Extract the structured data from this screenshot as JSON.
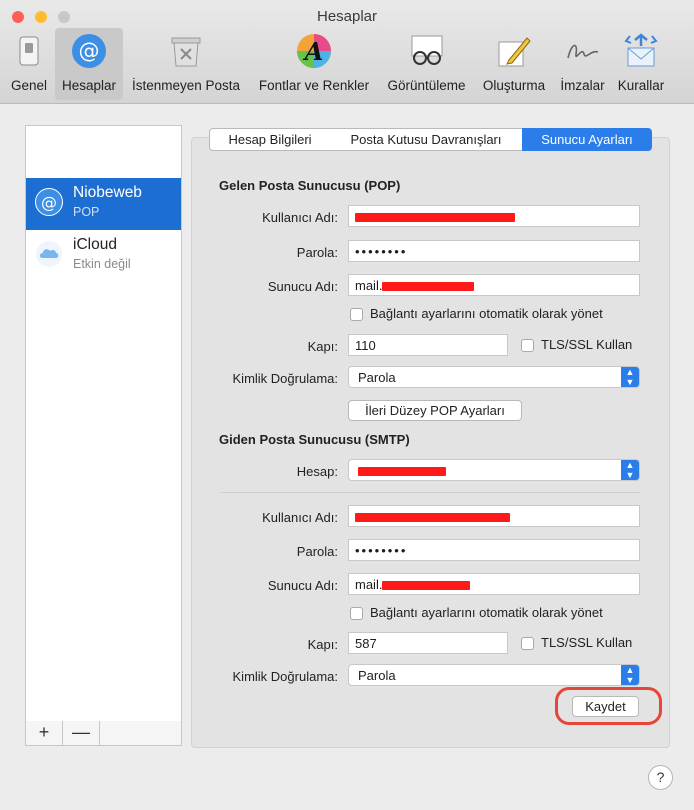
{
  "window": {
    "title": "Hesaplar",
    "traffic_lights": {
      "close": "#fe5f57",
      "minimize": "#febc2e",
      "zoom": "#c8c8c8"
    }
  },
  "toolbar": {
    "items": [
      {
        "label": "Genel",
        "icon": "switch-icon"
      },
      {
        "label": "Hesaplar",
        "icon": "at-sign-icon",
        "active": true
      },
      {
        "label": "İstenmeyen Posta",
        "icon": "trash-junk-icon"
      },
      {
        "label": "Fontlar ve Renkler",
        "icon": "font-colors-icon"
      },
      {
        "label": "Görüntüleme",
        "icon": "glasses-icon"
      },
      {
        "label": "Oluşturma",
        "icon": "pencil-icon"
      },
      {
        "label": "İmzalar",
        "icon": "signature-icon"
      },
      {
        "label": "Kurallar",
        "icon": "rules-envelope-icon"
      }
    ]
  },
  "accounts": [
    {
      "name": "Niobeweb",
      "type": "POP",
      "selected": true,
      "icon": "at-sign-icon"
    },
    {
      "name": "iCloud",
      "type": "Etkin değil",
      "selected": false,
      "icon": "cloud-icon"
    }
  ],
  "list_buttons": {
    "add": "+",
    "remove": "—"
  },
  "tabs": [
    "Hesap Bilgileri",
    "Posta Kutusu Davranışları",
    "Sunucu Ayarları"
  ],
  "active_tab": "Sunucu Ayarları",
  "incoming": {
    "section_title": "Gelen Posta Sunucusu (POP)",
    "username_label": "Kullanıcı Adı:",
    "password_label": "Parola:",
    "password_value": "••••••••",
    "server_label": "Sunucu Adı:",
    "server_value_prefix": "mail.",
    "auto_manage_label": "Bağlantı ayarlarını otomatik olarak yönet",
    "port_label": "Kapı:",
    "port_value": "110",
    "tls_label": "TLS/SSL Kullan",
    "auth_label": "Kimlik Doğrulama:",
    "auth_value": "Parola",
    "advanced_button": "İleri Düzey POP Ayarları"
  },
  "outgoing": {
    "section_title": "Giden Posta Sunucusu (SMTP)",
    "account_label": "Hesap:",
    "username_label": "Kullanıcı Adı:",
    "password_label": "Parola:",
    "password_value": "••••••••",
    "server_label": "Sunucu Adı:",
    "server_value_prefix": "mail.",
    "auto_manage_label": "Bağlantı ayarlarını otomatik olarak yönet",
    "port_label": "Kapı:",
    "port_value": "587",
    "tls_label": "TLS/SSL Kullan",
    "auth_label": "Kimlik Doğrulama:",
    "auth_value": "Parola"
  },
  "save_button": "Kaydet",
  "help_button": "?",
  "colors": {
    "accent": "#2b7de9",
    "selection": "#1c6ed2",
    "redaction": "#ff1a1a",
    "highlight": "#e8453a"
  }
}
